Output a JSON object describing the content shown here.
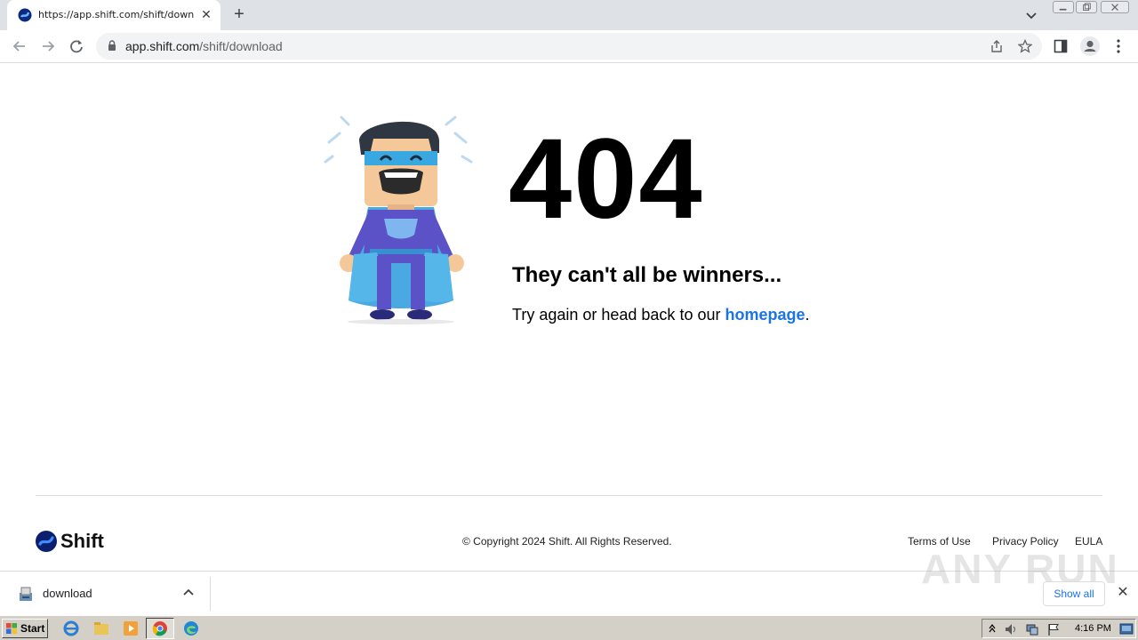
{
  "browser": {
    "tab": {
      "title": "https://app.shift.com/shift/download",
      "close_glyph": "✕"
    },
    "new_tab_glyph": "+",
    "omnibox": {
      "domain": "app.shift.com",
      "path": "/shift/download"
    }
  },
  "page": {
    "error_code": "404",
    "heading": "They can't all be winners...",
    "text_before": "Try again or head back to our ",
    "link_label": "homepage",
    "text_after": ".",
    "footer": {
      "brand": "Shift",
      "copyright": "© Copyright 2024 Shift. All Rights Reserved.",
      "links": [
        "Terms of Use",
        "Privacy Policy",
        "EULA"
      ]
    }
  },
  "download_bar": {
    "file_name": "download",
    "show_all": "Show all",
    "close_glyph": "✕",
    "watermark": "ANY RUN"
  },
  "taskbar": {
    "start_label": "Start",
    "clock": "4:16 PM"
  },
  "colors": {
    "link": "#1a73e8",
    "brand_blue": "#1f4fd6",
    "tabstrip": "#dee1e6"
  }
}
